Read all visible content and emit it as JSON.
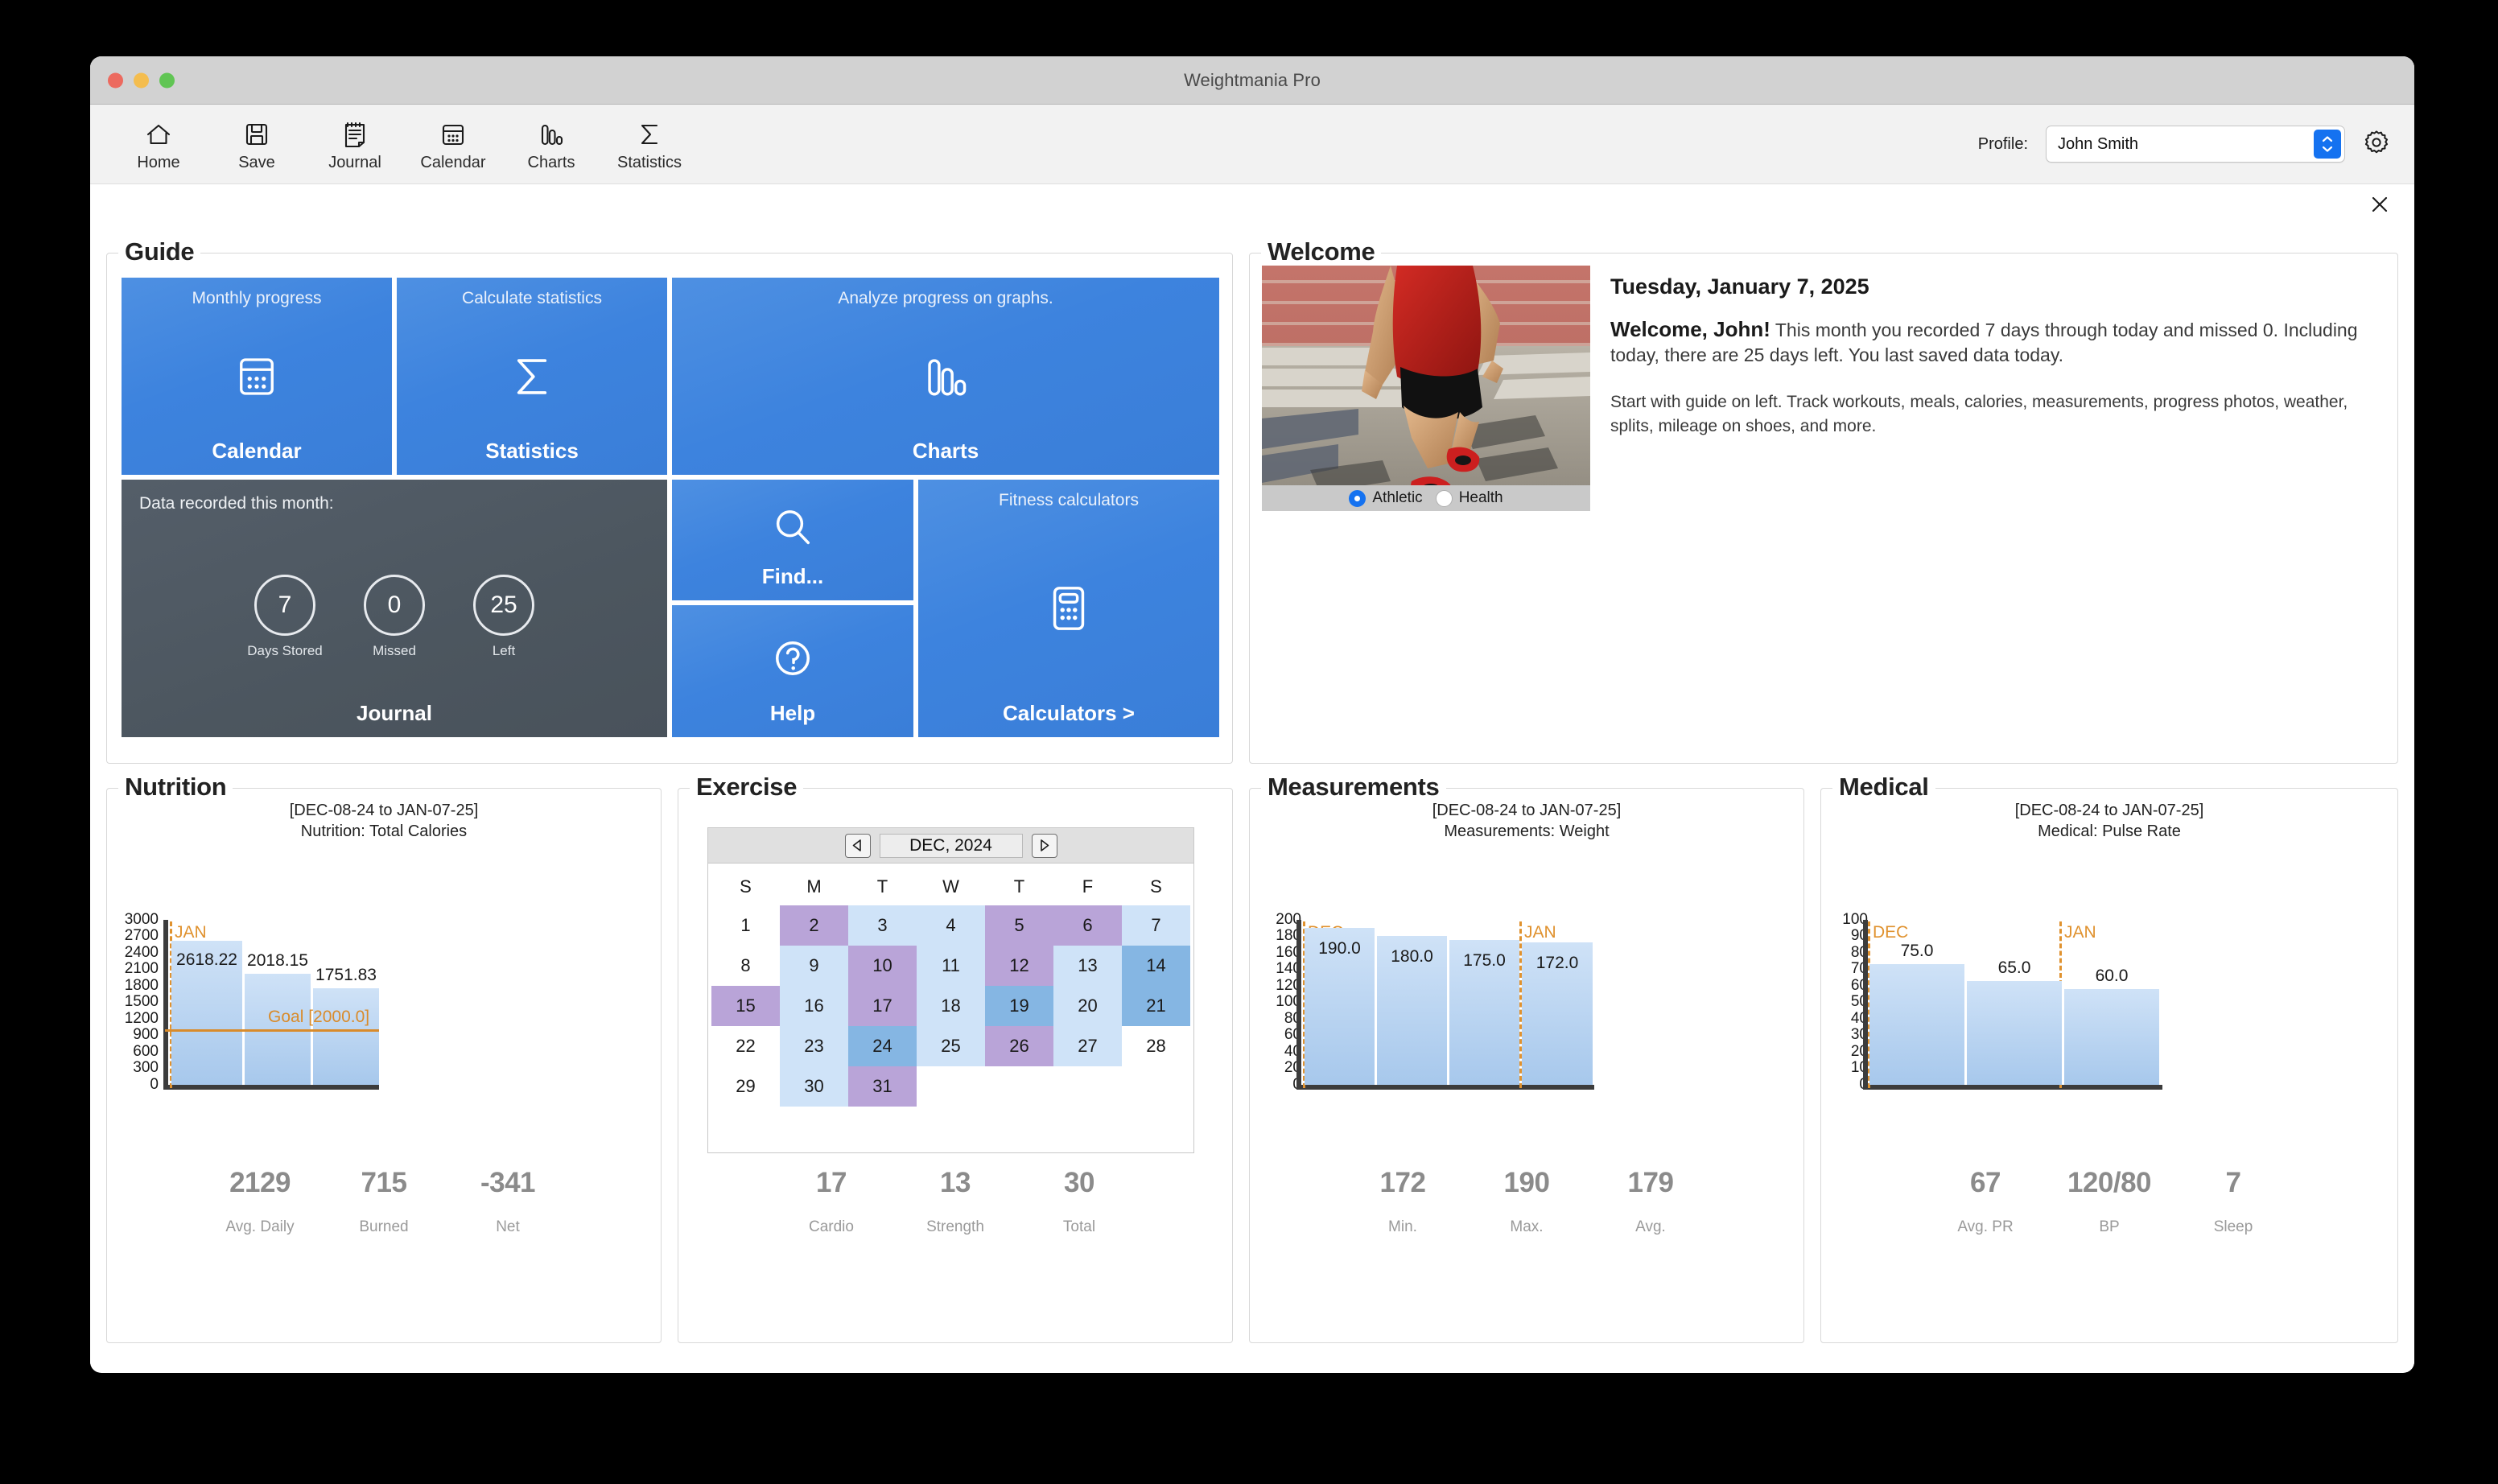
{
  "window": {
    "title": "Weightmania Pro"
  },
  "toolbar": {
    "items": [
      {
        "label": "Home",
        "icon": "home-icon"
      },
      {
        "label": "Save",
        "icon": "save-icon"
      },
      {
        "label": "Journal",
        "icon": "journal-icon"
      },
      {
        "label": "Calendar",
        "icon": "calendar-icon"
      },
      {
        "label": "Charts",
        "icon": "charts-icon"
      },
      {
        "label": "Statistics",
        "icon": "sigma-icon"
      }
    ],
    "profile_label": "Profile:",
    "profile_value": "John Smith",
    "gear_icon": "gear-icon"
  },
  "guide": {
    "legend": "Guide",
    "tiles": [
      {
        "top": "Monthly progress",
        "bottom": "Calendar",
        "icon": "calendar-icon"
      },
      {
        "top": "Calculate statistics",
        "bottom": "Statistics",
        "icon": "sigma-icon"
      },
      {
        "top": "Analyze progress on graphs.",
        "bottom": "Charts",
        "icon": "bars-icon"
      },
      {
        "top": "",
        "bottom": "Find...",
        "icon": "search-icon"
      },
      {
        "top": "",
        "bottom": "Help",
        "icon": "question-icon"
      },
      {
        "top": "Fitness calculators",
        "bottom": "Calculators >",
        "icon": "calculator-icon"
      }
    ],
    "journal_tile": {
      "caption": "Data recorded this month:",
      "bottom": "Journal",
      "stats": [
        {
          "value": "7",
          "label": "Days Stored"
        },
        {
          "value": "0",
          "label": "Missed"
        },
        {
          "value": "25",
          "label": "Left"
        }
      ]
    }
  },
  "welcome": {
    "legend": "Welcome",
    "date": "Tuesday, January 7, 2025",
    "greeting": "Welcome, John!",
    "message": " This month you recorded 7 days through today and missed 0. Including today, there are 25 days left. You last saved data today.",
    "hint": "Start with guide on left. Track workouts, meals, calories, measurements, progress photos, weather, splits, mileage on shoes, and more.",
    "photo_alt": "runner-photo",
    "modes": [
      {
        "label": "Athletic",
        "selected": true
      },
      {
        "label": "Health",
        "selected": false
      }
    ]
  },
  "close_icon": "close-icon",
  "panels": {
    "nutrition": {
      "legend": "Nutrition",
      "stats": [
        {
          "value": "2129",
          "label": "Avg. Daily"
        },
        {
          "value": "715",
          "label": "Burned"
        },
        {
          "value": "-341",
          "label": "Net"
        }
      ]
    },
    "exercise": {
      "legend": "Exercise",
      "calendar": {
        "month_label": "DEC, 2024",
        "prev_icon": "chevron-left-icon",
        "next_icon": "chevron-right-icon",
        "dow": [
          "S",
          "M",
          "T",
          "W",
          "T",
          "F",
          "S"
        ],
        "weeks": [
          [
            {
              "d": "1",
              "s": "none"
            },
            {
              "d": "2",
              "s": "purple"
            },
            {
              "d": "3",
              "s": "light"
            },
            {
              "d": "4",
              "s": "light"
            },
            {
              "d": "5",
              "s": "purple"
            },
            {
              "d": "6",
              "s": "purple"
            },
            {
              "d": "7",
              "s": "light"
            }
          ],
          [
            {
              "d": "8",
              "s": "none"
            },
            {
              "d": "9",
              "s": "light"
            },
            {
              "d": "10",
              "s": "purple"
            },
            {
              "d": "11",
              "s": "light"
            },
            {
              "d": "12",
              "s": "purple"
            },
            {
              "d": "13",
              "s": "light"
            },
            {
              "d": "14",
              "s": "blue"
            }
          ],
          [
            {
              "d": "15",
              "s": "purple"
            },
            {
              "d": "16",
              "s": "light"
            },
            {
              "d": "17",
              "s": "purple"
            },
            {
              "d": "18",
              "s": "light"
            },
            {
              "d": "19",
              "s": "blue"
            },
            {
              "d": "20",
              "s": "light"
            },
            {
              "d": "21",
              "s": "blue"
            }
          ],
          [
            {
              "d": "22",
              "s": "none"
            },
            {
              "d": "23",
              "s": "light"
            },
            {
              "d": "24",
              "s": "blue"
            },
            {
              "d": "25",
              "s": "light"
            },
            {
              "d": "26",
              "s": "purple"
            },
            {
              "d": "27",
              "s": "light"
            },
            {
              "d": "28",
              "s": "none"
            }
          ],
          [
            {
              "d": "29",
              "s": "none"
            },
            {
              "d": "30",
              "s": "light"
            },
            {
              "d": "31",
              "s": "purple"
            },
            {
              "d": "",
              "s": "none"
            },
            {
              "d": "",
              "s": "none"
            },
            {
              "d": "",
              "s": "none"
            },
            {
              "d": "",
              "s": "none"
            }
          ]
        ]
      },
      "stats": [
        {
          "value": "17",
          "label": "Cardio"
        },
        {
          "value": "13",
          "label": "Strength"
        },
        {
          "value": "30",
          "label": "Total"
        }
      ]
    },
    "measurements": {
      "legend": "Measurements",
      "stats": [
        {
          "value": "172",
          "label": "Min."
        },
        {
          "value": "190",
          "label": "Max."
        },
        {
          "value": "179",
          "label": "Avg."
        }
      ]
    },
    "medical": {
      "legend": "Medical",
      "stats": [
        {
          "value": "67",
          "label": "Avg. PR"
        },
        {
          "value": "120/80",
          "label": "BP"
        },
        {
          "value": "7",
          "label": "Sleep"
        }
      ]
    }
  },
  "chart_data": [
    {
      "id": "nutrition",
      "type": "bar",
      "title": "[DEC-08-24 to JAN-07-25]",
      "subtitle": "Nutrition:  Total Calories",
      "categories": [
        "",
        "",
        ""
      ],
      "values": [
        2618.22,
        2018.15,
        1751.83
      ],
      "data_labels": [
        "2618.22",
        "2018.15",
        "1751.83"
      ],
      "ylim": [
        0,
        3000
      ],
      "yticks": [
        3000,
        2700,
        2400,
        2100,
        1800,
        1500,
        1200,
        900,
        600,
        300,
        0
      ],
      "ylabel": "",
      "xlabel": "",
      "grid": false,
      "goal": {
        "value": 2000.0,
        "label": "Goal [2000.0]",
        "color": "#d98b2b"
      },
      "month_markers": [
        {
          "label": "JAN",
          "at": 0.02,
          "color": "#e0922f"
        }
      ],
      "bar_color": "#a7c8ec"
    },
    {
      "id": "measurements",
      "type": "bar",
      "title": "[DEC-08-24 to JAN-07-25]",
      "subtitle": "Measurements:  Weight",
      "categories": [
        "",
        "",
        "",
        ""
      ],
      "values": [
        190.0,
        180.0,
        175.0,
        172.0
      ],
      "data_labels": [
        "190.0",
        "180.0",
        "175.0",
        "172.0"
      ],
      "ylim": [
        0,
        200
      ],
      "yticks": [
        200,
        180,
        160,
        140,
        120,
        100,
        80,
        60,
        40,
        20,
        0
      ],
      "ylabel": "",
      "xlabel": "",
      "grid": false,
      "month_markers": [
        {
          "label": "DEC",
          "at": 0.02,
          "color": "#e0922f"
        },
        {
          "label": "JAN",
          "at": 0.735,
          "color": "#e0922f"
        }
      ],
      "bar_color": "#a7c8ec"
    },
    {
      "id": "medical",
      "type": "bar",
      "title": "[DEC-08-24 to JAN-07-25]",
      "subtitle": "Medical:  Pulse Rate",
      "categories": [
        "",
        "",
        ""
      ],
      "values": [
        75.0,
        65.0,
        60.0
      ],
      "data_labels": [
        "75.0",
        "65.0",
        "60.0"
      ],
      "ylim": [
        0,
        100
      ],
      "yticks": [
        100,
        90,
        80,
        70,
        60,
        50,
        40,
        30,
        20,
        10,
        0
      ],
      "ylabel": "",
      "xlabel": "",
      "grid": false,
      "month_markers": [
        {
          "label": "DEC",
          "at": 0.01,
          "color": "#e0922f"
        },
        {
          "label": "JAN",
          "at": 0.655,
          "color": "#e0922f"
        }
      ],
      "bar_color": "#a7c8ec"
    }
  ]
}
